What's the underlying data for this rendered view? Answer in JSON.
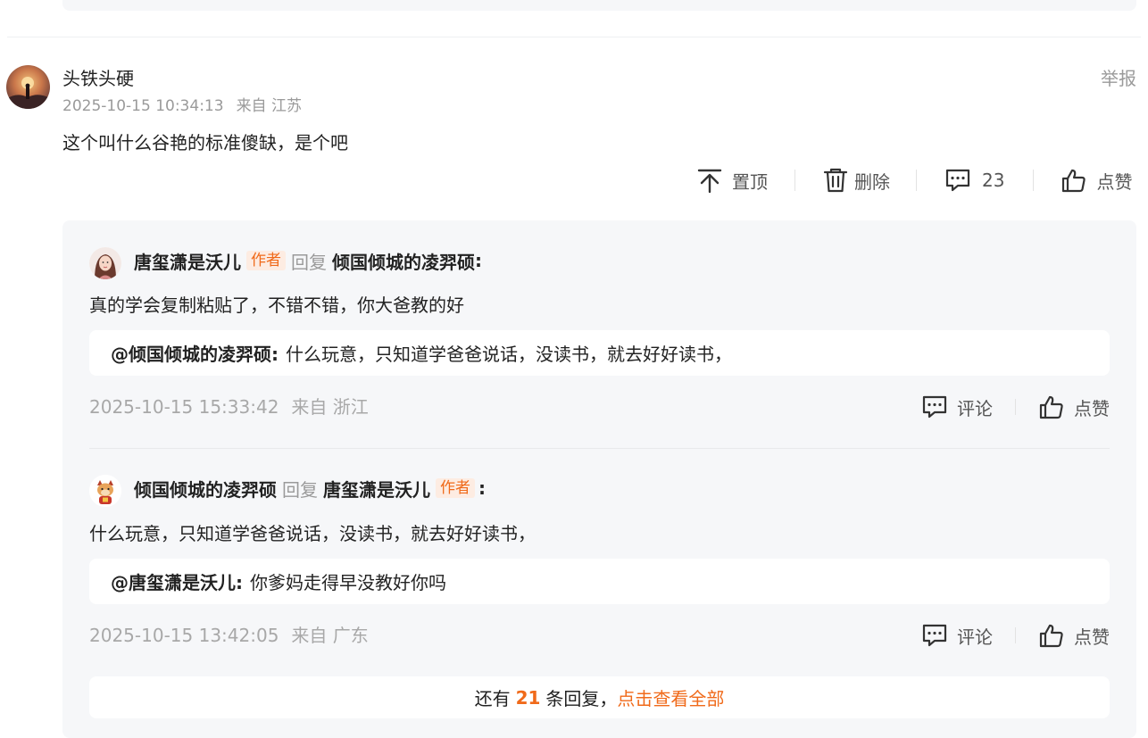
{
  "comment": {
    "username": "头铁头硬",
    "timestamp": "2025-10-15 10:34:13",
    "location": "来自 江苏",
    "report_label": "举报",
    "text": "这个叫什么谷艳的标准傻缺，是个吧",
    "actions": {
      "pin_label": "置顶",
      "delete_label": "删除",
      "comment_count": "23",
      "like_label": "点赞"
    }
  },
  "replies": [
    {
      "author": "唐玺潇是沃儿",
      "author_tag": "作者",
      "reply_word": "回复",
      "target": "倾国倾城的凌羿硕",
      "colon": ":",
      "text": "真的学会复制粘贴了，不错不错，你大爸教的好",
      "quote_name": "@倾国倾城的凌羿硕:",
      "quote_text": "什么玩意，只知道学爸爸说话，没读书，就去好好读书，",
      "timestamp": "2025-10-15 15:33:42",
      "location": "来自 浙江",
      "comment_label": "评论",
      "like_label": "点赞"
    },
    {
      "author": "倾国倾城的凌羿硕",
      "reply_word": "回复",
      "target": "唐玺潇是沃儿",
      "target_tag": "作者",
      "colon": ":",
      "text": "什么玩意，只知道学爸爸说话，没读书，就去好好读书，",
      "quote_name": "@唐玺潇是沃儿:",
      "quote_text": "你爹妈走得早没教好你吗",
      "timestamp": "2025-10-15 13:42:05",
      "location": "来自 广东",
      "comment_label": "评论",
      "like_label": "点赞"
    }
  ],
  "more_replies": {
    "prefix": "还有",
    "count": "21",
    "suffix": "条回复，",
    "link": "点击查看全部"
  },
  "colors": {
    "accent": "#f06a1a",
    "tag_bg": "#fdece2",
    "panel_bg": "#f6f7f9",
    "muted_text": "#9a9a9a"
  },
  "icons": [
    "pin-top-icon",
    "trash-icon",
    "comment-bubble-icon",
    "thumbs-up-icon"
  ]
}
